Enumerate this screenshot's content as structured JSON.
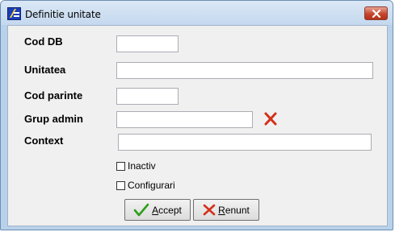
{
  "window": {
    "title": "Definitie unitate",
    "icon": "app-form-icon",
    "close": "close-icon"
  },
  "form": {
    "cod_db": {
      "label": "Cod DB",
      "value": ""
    },
    "unitatea": {
      "label": "Unitatea",
      "value": ""
    },
    "cod_parinte": {
      "label": "Cod parinte",
      "value": ""
    },
    "grup_admin": {
      "label": "Grup admin",
      "value": "",
      "clear_icon": "red-x-icon"
    },
    "context": {
      "label": "Context",
      "value": ""
    }
  },
  "options": {
    "inactiv": {
      "label": "Inactiv",
      "checked": false
    },
    "configurari": {
      "label": "Configurari",
      "checked": false
    }
  },
  "buttons": {
    "accept": {
      "mnemonic": "A",
      "rest": "ccept",
      "icon": "green-check-icon"
    },
    "renunt": {
      "mnemonic": "R",
      "rest": "enunt",
      "icon": "red-x-icon"
    }
  },
  "colors": {
    "window_frame": "#b9d1ea",
    "client_bg": "#f0f0f0",
    "close_red": "#c7452e",
    "accept_green": "#2e9e1a",
    "cancel_red": "#d4301a"
  }
}
